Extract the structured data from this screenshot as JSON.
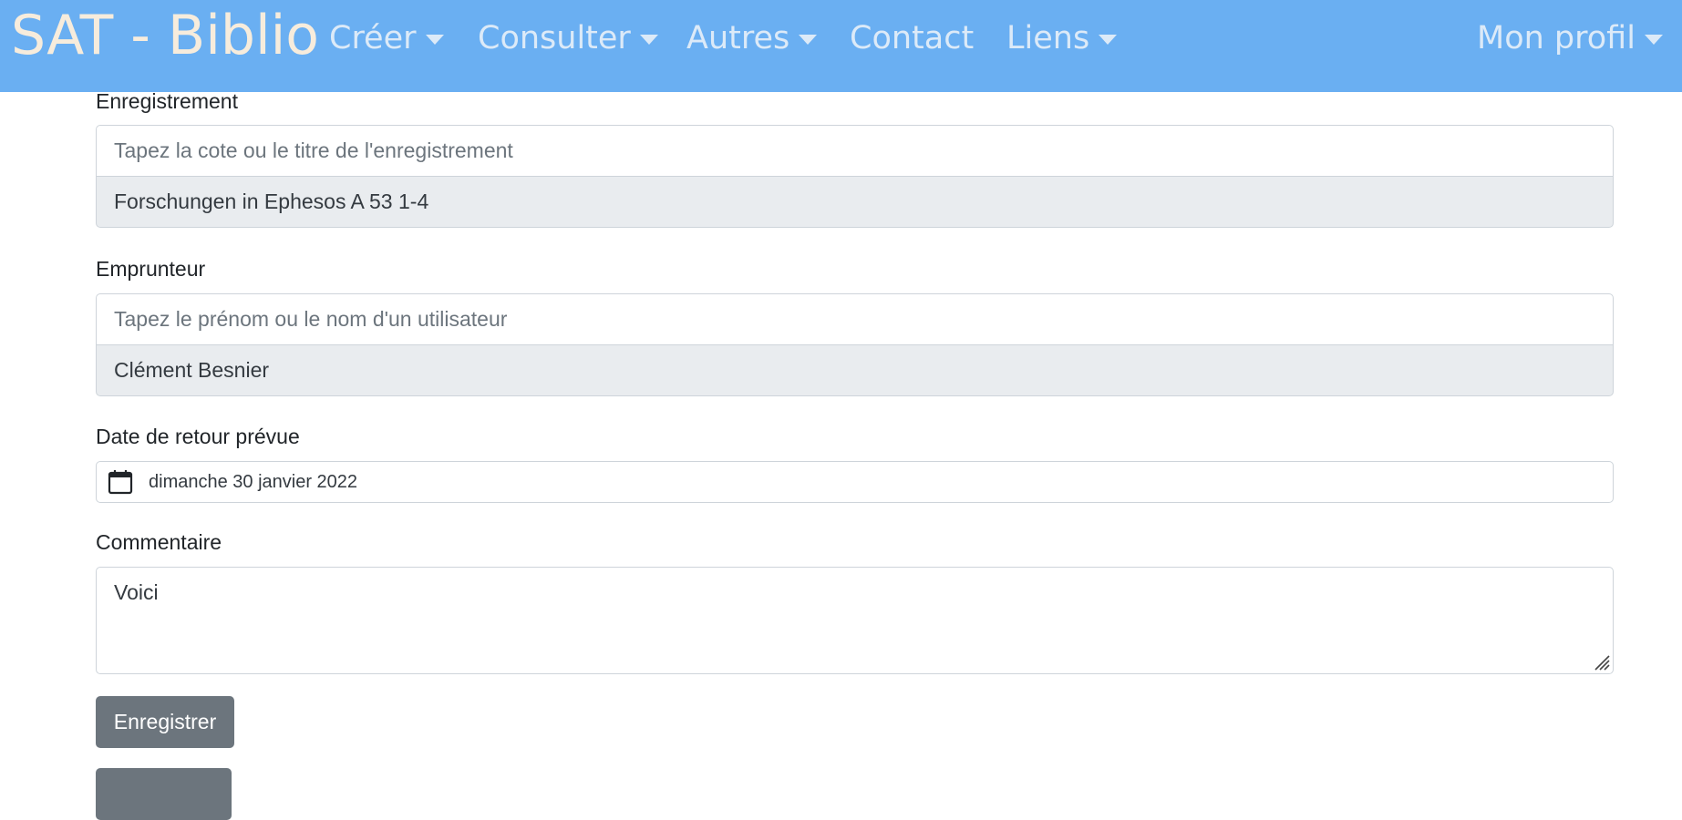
{
  "navbar": {
    "brand": "SAT - Biblio",
    "items": [
      {
        "label": "Créer",
        "dropdown": true
      },
      {
        "label": "Consulter",
        "dropdown": true
      },
      {
        "label": "Autres",
        "dropdown": true
      },
      {
        "label": "Contact",
        "dropdown": false
      },
      {
        "label": "Liens",
        "dropdown": true
      }
    ],
    "profile": "Mon profil",
    "background_color": "#6aaff2"
  },
  "form": {
    "enregistrement": {
      "label": "Enregistrement",
      "placeholder": "Tapez la cote ou le titre de l'enregistrement",
      "selected": "Forschungen in Ephesos A 53 1-4"
    },
    "emprunteur": {
      "label": "Emprunteur",
      "placeholder": "Tapez le prénom ou le nom d'un utilisateur",
      "selected": "Clément Besnier"
    },
    "date_retour": {
      "label": "Date de retour prévue",
      "value": "dimanche 30 janvier 2022",
      "icon": "calendar-icon"
    },
    "commentaire": {
      "label": "Commentaire",
      "value": "Voici"
    },
    "buttons": {
      "save_label": "Enregistrer",
      "button_color": "#6c757d"
    }
  }
}
